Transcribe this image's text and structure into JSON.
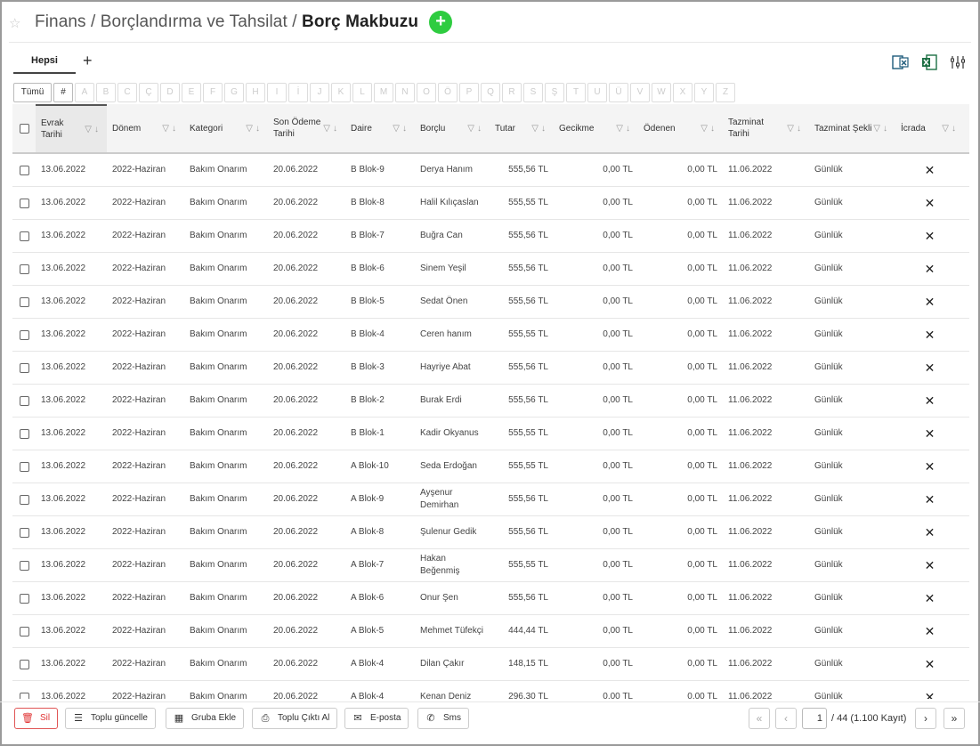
{
  "header": {
    "breadcrumb": "Finans / Borçlandırma ve Tahsilat / ",
    "title": "Borç Makbuzu",
    "add_label": "+"
  },
  "tabs": [
    {
      "label": "Hepsi"
    }
  ],
  "tab_add": "+",
  "letters": [
    "Tümü",
    "#",
    "A",
    "B",
    "C",
    "Ç",
    "D",
    "E",
    "F",
    "G",
    "H",
    "I",
    "İ",
    "J",
    "K",
    "L",
    "M",
    "N",
    "O",
    "Ö",
    "P",
    "Q",
    "R",
    "S",
    "Ş",
    "T",
    "U",
    "Ü",
    "V",
    "W",
    "X",
    "Y",
    "Z"
  ],
  "columns": [
    "Evrak Tarihi",
    "Dönem",
    "Kategori",
    "Son Ödeme Tarihi",
    "Daire",
    "Borçlu",
    "Tutar",
    "Gecikme",
    "Ödenen",
    "Tazminat Tarihi",
    "Tazminat Şekli",
    "İcrada"
  ],
  "rows": [
    [
      "13.06.2022",
      "2022-Haziran",
      "Bakım Onarım",
      "20.06.2022",
      "B Blok-9",
      "Derya Hanım",
      "555,56 TL",
      "0,00 TL",
      "0,00 TL",
      "11.06.2022",
      "Günlük",
      "✕"
    ],
    [
      "13.06.2022",
      "2022-Haziran",
      "Bakım Onarım",
      "20.06.2022",
      "B Blok-8",
      "Halil Kılıçaslan",
      "555,55 TL",
      "0,00 TL",
      "0,00 TL",
      "11.06.2022",
      "Günlük",
      "✕"
    ],
    [
      "13.06.2022",
      "2022-Haziran",
      "Bakım Onarım",
      "20.06.2022",
      "B Blok-7",
      "Buğra Can",
      "555,56 TL",
      "0,00 TL",
      "0,00 TL",
      "11.06.2022",
      "Günlük",
      "✕"
    ],
    [
      "13.06.2022",
      "2022-Haziran",
      "Bakım Onarım",
      "20.06.2022",
      "B Blok-6",
      "Sinem Yeşil",
      "555,56 TL",
      "0,00 TL",
      "0,00 TL",
      "11.06.2022",
      "Günlük",
      "✕"
    ],
    [
      "13.06.2022",
      "2022-Haziran",
      "Bakım Onarım",
      "20.06.2022",
      "B Blok-5",
      "Sedat Önen",
      "555,56 TL",
      "0,00 TL",
      "0,00 TL",
      "11.06.2022",
      "Günlük",
      "✕"
    ],
    [
      "13.06.2022",
      "2022-Haziran",
      "Bakım Onarım",
      "20.06.2022",
      "B Blok-4",
      "Ceren hanım",
      "555,55 TL",
      "0,00 TL",
      "0,00 TL",
      "11.06.2022",
      "Günlük",
      "✕"
    ],
    [
      "13.06.2022",
      "2022-Haziran",
      "Bakım Onarım",
      "20.06.2022",
      "B Blok-3",
      "Hayriye Abat",
      "555,56 TL",
      "0,00 TL",
      "0,00 TL",
      "11.06.2022",
      "Günlük",
      "✕"
    ],
    [
      "13.06.2022",
      "2022-Haziran",
      "Bakım Onarım",
      "20.06.2022",
      "B Blok-2",
      "Burak Erdi",
      "555,56 TL",
      "0,00 TL",
      "0,00 TL",
      "11.06.2022",
      "Günlük",
      "✕"
    ],
    [
      "13.06.2022",
      "2022-Haziran",
      "Bakım Onarım",
      "20.06.2022",
      "B Blok-1",
      "Kadir Okyanus",
      "555,55 TL",
      "0,00 TL",
      "0,00 TL",
      "11.06.2022",
      "Günlük",
      "✕"
    ],
    [
      "13.06.2022",
      "2022-Haziran",
      "Bakım Onarım",
      "20.06.2022",
      "A Blok-10",
      "Seda Erdoğan",
      "555,55 TL",
      "0,00 TL",
      "0,00 TL",
      "11.06.2022",
      "Günlük",
      "✕"
    ],
    [
      "13.06.2022",
      "2022-Haziran",
      "Bakım Onarım",
      "20.06.2022",
      "A Blok-9",
      "Ayşenur Demirhan",
      "555,56 TL",
      "0,00 TL",
      "0,00 TL",
      "11.06.2022",
      "Günlük",
      "✕"
    ],
    [
      "13.06.2022",
      "2022-Haziran",
      "Bakım Onarım",
      "20.06.2022",
      "A Blok-8",
      "Şulenur Gedik",
      "555,56 TL",
      "0,00 TL",
      "0,00 TL",
      "11.06.2022",
      "Günlük",
      "✕"
    ],
    [
      "13.06.2022",
      "2022-Haziran",
      "Bakım Onarım",
      "20.06.2022",
      "A Blok-7",
      "Hakan Beğenmiş",
      "555,55 TL",
      "0,00 TL",
      "0,00 TL",
      "11.06.2022",
      "Günlük",
      "✕"
    ],
    [
      "13.06.2022",
      "2022-Haziran",
      "Bakım Onarım",
      "20.06.2022",
      "A Blok-6",
      "Onur Şen",
      "555,56 TL",
      "0,00 TL",
      "0,00 TL",
      "11.06.2022",
      "Günlük",
      "✕"
    ],
    [
      "13.06.2022",
      "2022-Haziran",
      "Bakım Onarım",
      "20.06.2022",
      "A Blok-5",
      "Mehmet Tüfekçi",
      "444,44 TL",
      "0,00 TL",
      "0,00 TL",
      "11.06.2022",
      "Günlük",
      "✕"
    ],
    [
      "13.06.2022",
      "2022-Haziran",
      "Bakım Onarım",
      "20.06.2022",
      "A Blok-4",
      "Dilan Çakır",
      "148,15 TL",
      "0,00 TL",
      "0,00 TL",
      "11.06.2022",
      "Günlük",
      "✕"
    ],
    [
      "13.06.2022",
      "2022-Haziran",
      "Bakım Onarım",
      "20.06.2022",
      "A Blok-4",
      "Kenan Deniz",
      "296,30 TL",
      "0,00 TL",
      "0,00 TL",
      "11.06.2022",
      "Günlük",
      "✕"
    ]
  ],
  "footer": {
    "delete": "Sil",
    "bulk_update": "Toplu güncelle",
    "add_group": "Gruba Ekle",
    "bulk_print": "Toplu Çıktı Al",
    "email": "E-posta",
    "sms": "Sms",
    "page_value": "1",
    "page_info": "/ 44 (1.100 Kayıt)"
  },
  "colors": {
    "accent_green": "#2ecc40",
    "excel_green": "#1d7044",
    "delete_red": "#e03333"
  }
}
